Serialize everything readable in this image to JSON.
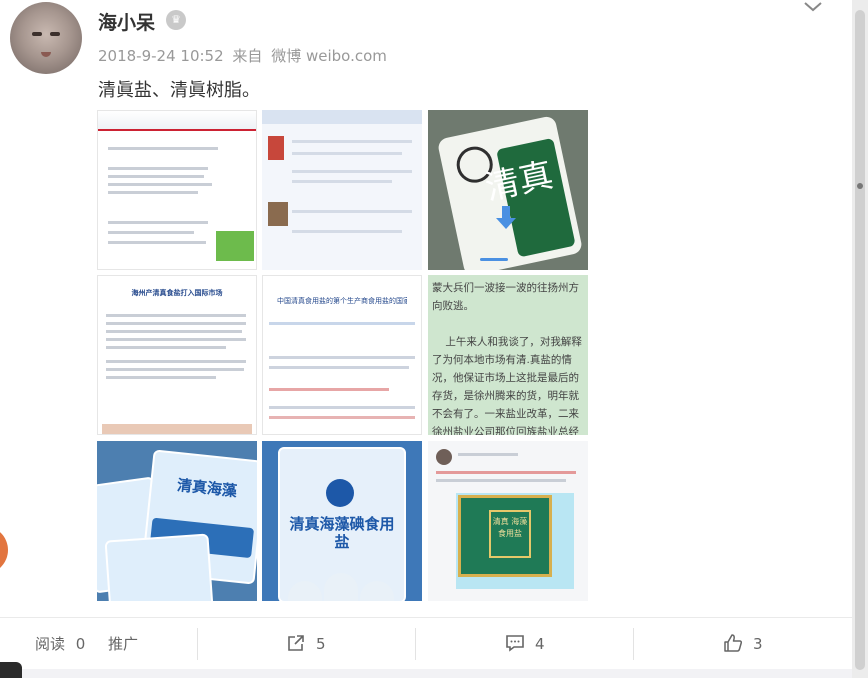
{
  "post": {
    "username": "海小呆",
    "date": "2018-9-24 10:52",
    "source_prefix": "来自",
    "source": "微博 weibo.com",
    "text": "清眞盐、清眞树脂。"
  },
  "images": {
    "t4_title": "海州产清真食盐打入国际市场",
    "t5_title": "中国清真食用盐的第个生产商食用盐的国家",
    "t6_text": "蒙大兵们一波接一波的往扬州方向败逃。\n\n    上午来人和我谈了，对我解释了为何本地市场有清.真盐的情况，他保证市场上这批是最后的存货，是徐州腾来的货，明年就不会有了。一来盐业改革，二来徐州盐业公司那位回族盐业总经理下台了。\n\n    怎么说呢，双方交谈是友好的",
    "t3_big": "清真",
    "t8_label": "清真海藻碘食用盐",
    "t7_label": "清真海藻",
    "t9_box_text": "清真 海藻 食用盐"
  },
  "footer": {
    "read_label": "阅读",
    "read_count": "0",
    "promote_label": "推广",
    "share_count": "5",
    "comment_count": "4",
    "like_count": "3"
  },
  "colors": {
    "accent": "#4a90e2",
    "text_primary": "#333333",
    "text_secondary": "#999999"
  },
  "icons": [
    "crown-icon",
    "chevron-down-icon",
    "download-icon",
    "share-icon",
    "comment-icon",
    "like-icon"
  ]
}
